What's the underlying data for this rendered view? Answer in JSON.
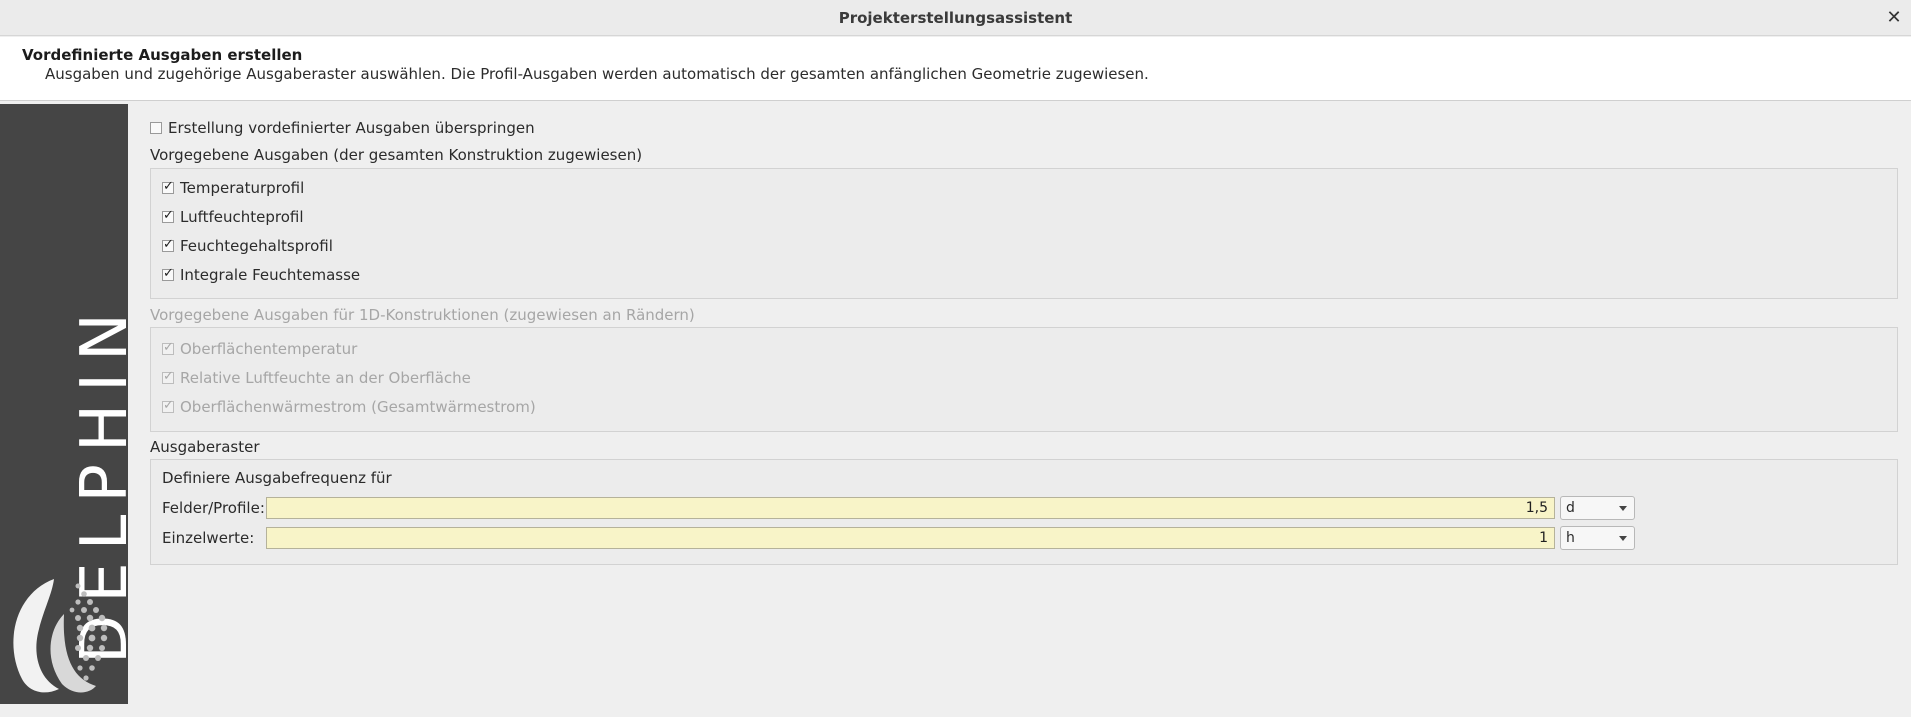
{
  "window": {
    "title": "Projekterstellungsassistent"
  },
  "header": {
    "title": "Vordefinierte Ausgaben erstellen",
    "subtitle": "Ausgaben und zugehörige Ausgaberaster auswählen. Die Profil-Ausgaben werden automatisch der gesamten anfänglichen Geometrie zugewiesen."
  },
  "sidebar": {
    "brand_text": "DELPHIN"
  },
  "skip": {
    "label": "Erstellung vordefinierter Ausgaben überspringen",
    "checked": false
  },
  "predefined": {
    "title": "Vorgegebene Ausgaben (der gesamten Konstruktion zugewiesen)",
    "items": [
      {
        "label": "Temperaturprofil",
        "checked": true
      },
      {
        "label": "Luftfeuchteprofil",
        "checked": true
      },
      {
        "label": "Feuchtegehaltsprofil",
        "checked": true
      },
      {
        "label": "Integrale Feuchtemasse",
        "checked": true
      }
    ]
  },
  "predefined_1d": {
    "title": "Vorgegebene Ausgaben für 1D-Konstruktionen (zugewiesen an Rändern)",
    "items": [
      {
        "label": "Oberflächentemperatur",
        "checked": true
      },
      {
        "label": "Relative Luftfeuchte an der Oberfläche",
        "checked": true
      },
      {
        "label": "Oberflächenwärmestrom (Gesamtwärmestrom)",
        "checked": true
      }
    ]
  },
  "grid": {
    "title": "Ausgaberaster",
    "subtitle": "Definiere Ausgabefrequenz für",
    "fields": {
      "label": "Felder/Profile:",
      "value": "1,5",
      "unit": "d"
    },
    "single": {
      "label": "Einzelwerte:",
      "value": "1",
      "unit": "h"
    }
  }
}
